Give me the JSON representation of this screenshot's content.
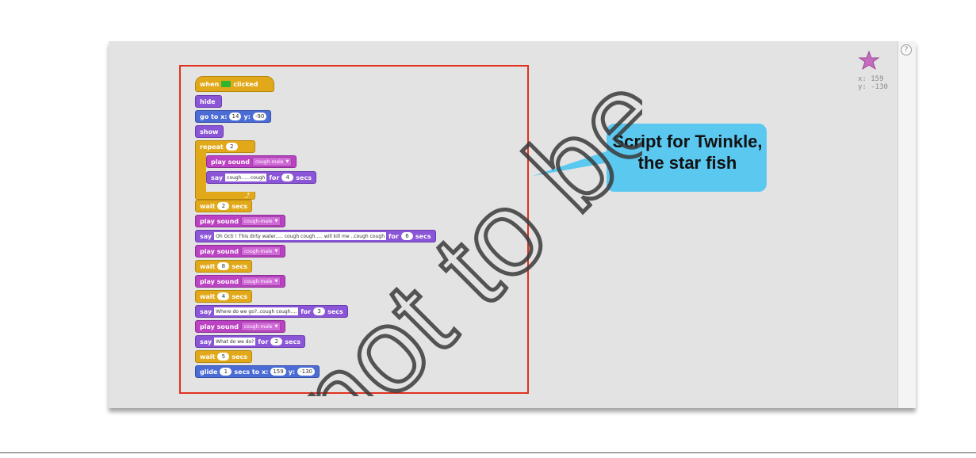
{
  "callout": {
    "line1": "Script for Twinkle,",
    "line2": "the star fish"
  },
  "sprite": {
    "x_label": "x: 159",
    "y_label": "y: -130"
  },
  "help": {
    "label": "?"
  },
  "watermark": {
    "text": "not to be ©"
  },
  "script": {
    "when": "when",
    "clicked": "clicked",
    "hide": "hide",
    "goto_label": "go to x:",
    "goto_x": "14",
    "goto_y_label": "y:",
    "goto_y": "-90",
    "show": "show",
    "repeat_label": "repeat",
    "repeat_n": "2",
    "play_sound": "play sound",
    "sound_name": "cough-male",
    "say": "say",
    "for": "for",
    "secs": "secs",
    "wait": "wait",
    "say1_text": "cough..... cough",
    "say1_secs": "4",
    "wait1": "2",
    "say2_text": "Oh Octi ! This dirty water..... cough cough..... will kill me ..cough cough",
    "say2_secs": "6",
    "wait2": "8",
    "wait3": "4",
    "say3_text": "Where do we go?..cough cough....",
    "say3_secs": "3",
    "say4_text": "What do we do?",
    "say4_secs": "2",
    "wait4": "5",
    "glide_label": "glide",
    "glide_secs": "1",
    "glide_mid": "secs to x:",
    "glide_x": "159",
    "glide_y_label": "y:",
    "glide_y": "-130"
  },
  "colors": {
    "control": "#e1a91a",
    "looks": "#8a55d7",
    "motion": "#4a6cd4",
    "sound": "#bb42c3",
    "highlight": "#e0321f",
    "callout": "#5bc8f0"
  }
}
